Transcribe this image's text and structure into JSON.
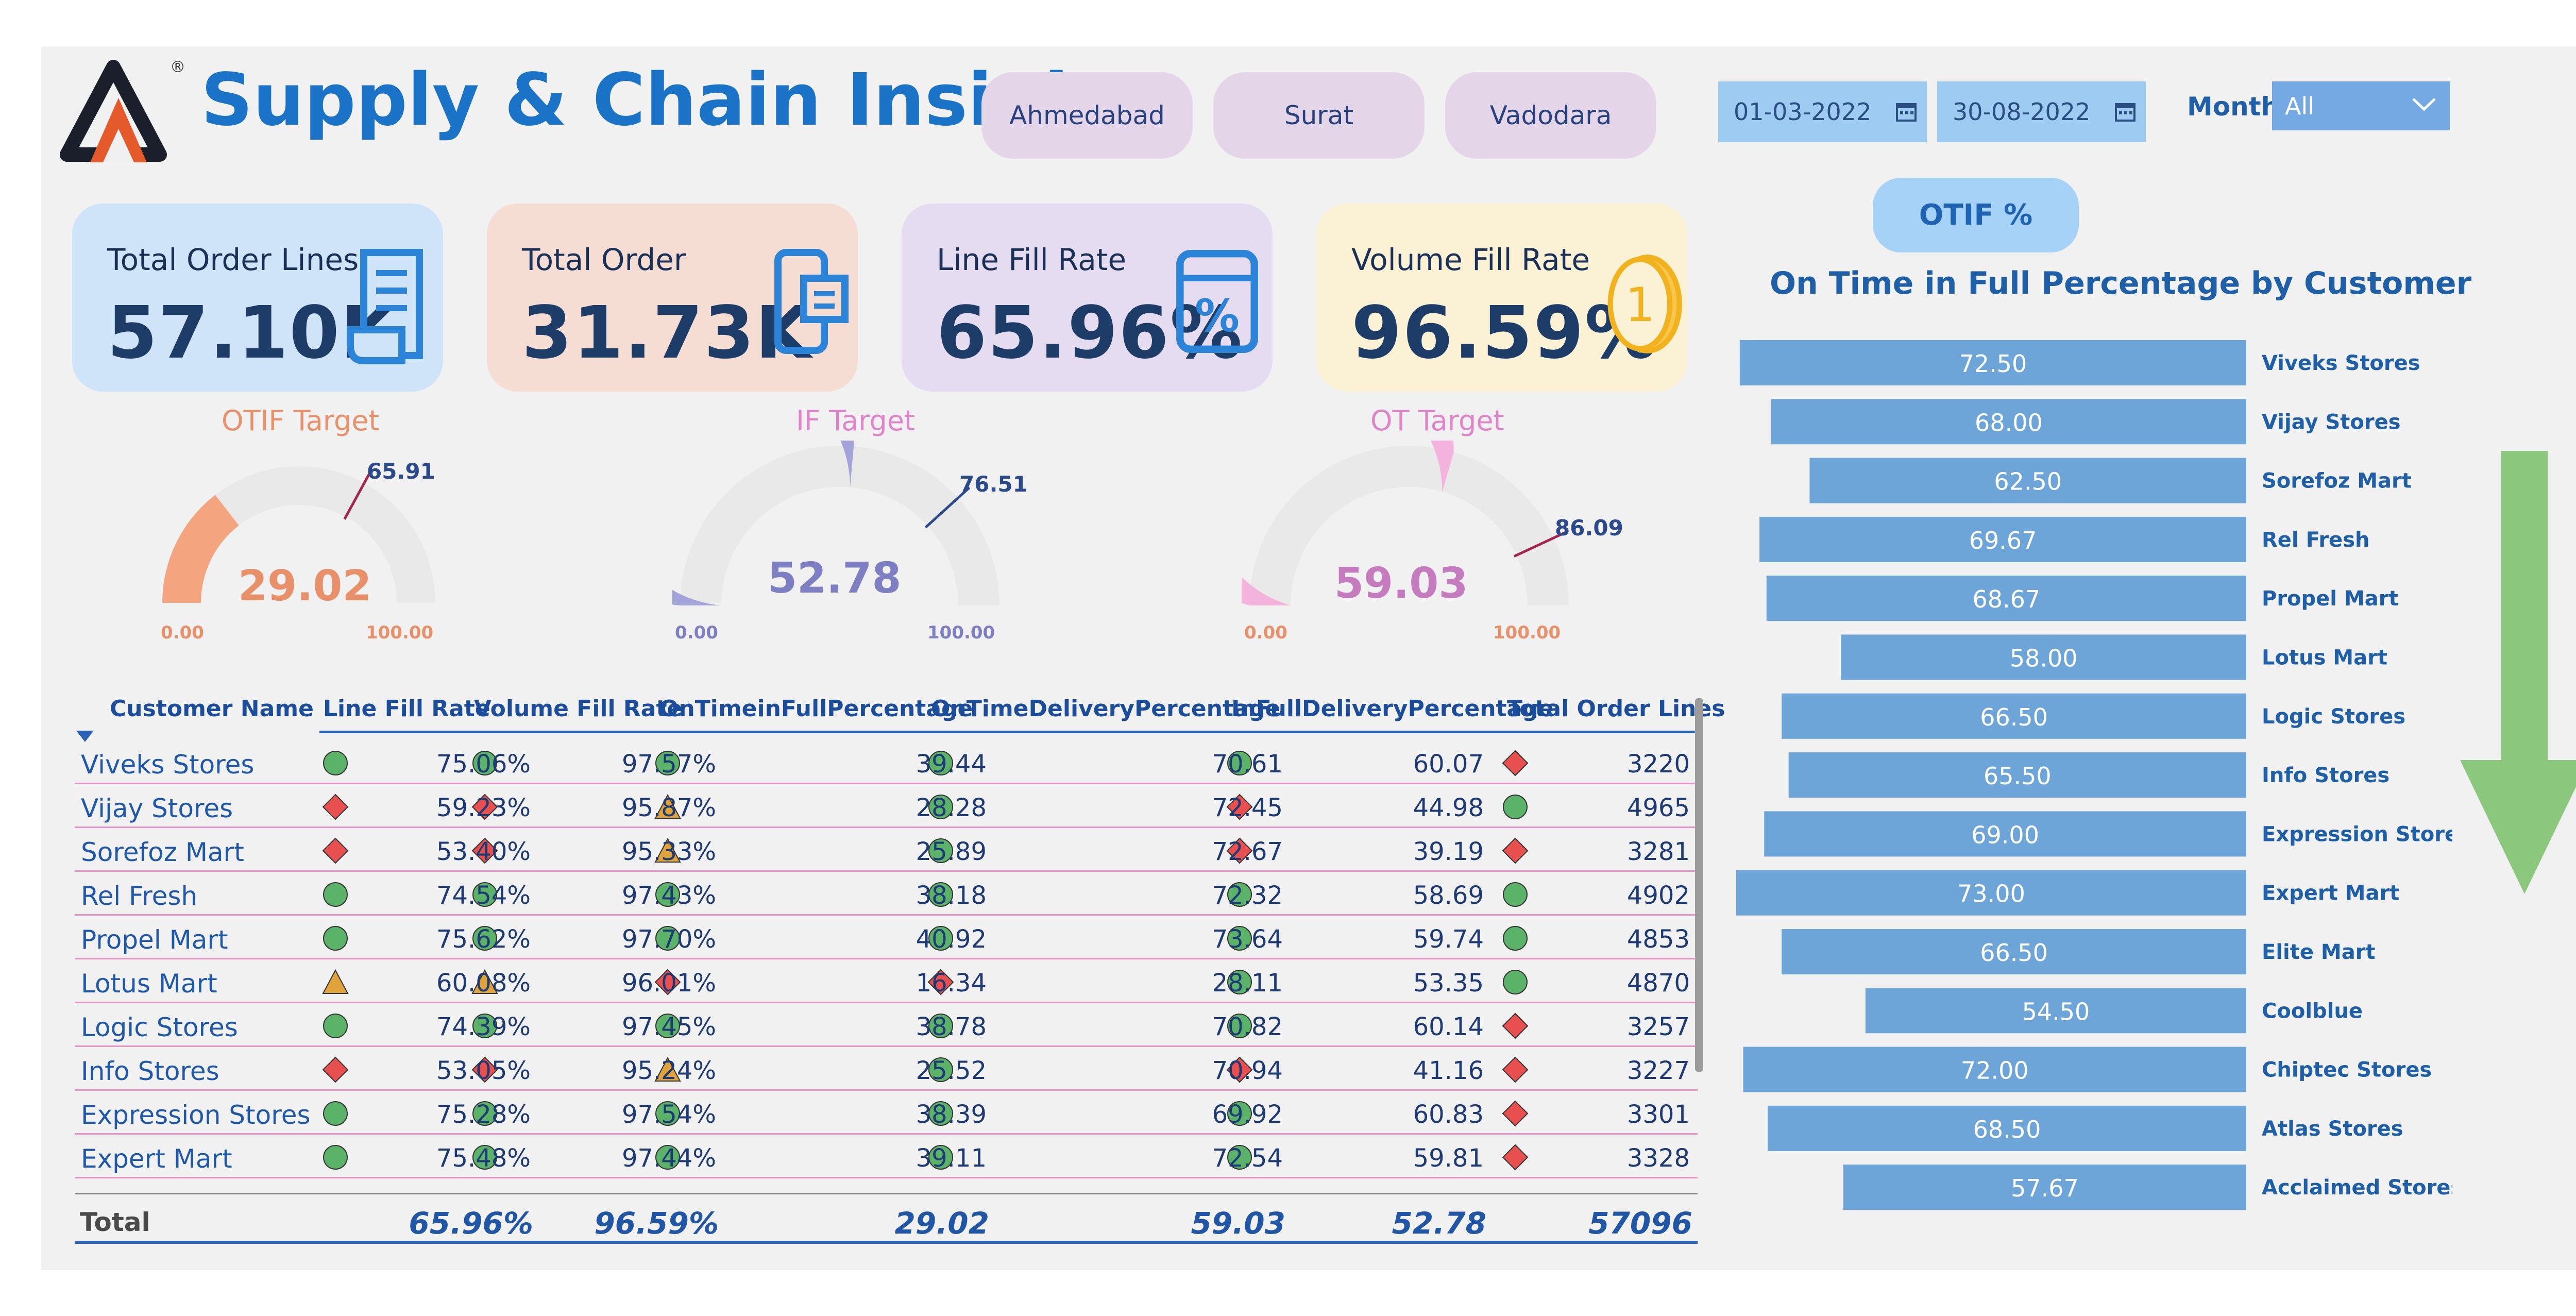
{
  "header": {
    "title": "Supply & Chain Insights",
    "cities": [
      "Ahmedabad",
      "Surat",
      "Vadodara"
    ],
    "start_date": "01-03-2022",
    "end_date": "30-08-2022",
    "month_label": "Month",
    "month_value": "All"
  },
  "kpis": [
    {
      "title": "Total Order Lines",
      "value": "57.10K",
      "icon": "document-icon",
      "bg": "#cfe4f8",
      "accent": "#2b84d8"
    },
    {
      "title": "Total Order",
      "value": "31.73K",
      "icon": "mobile-order-icon",
      "bg": "#f6ddd4",
      "accent": "#2b84d8"
    },
    {
      "title": "Line Fill Rate",
      "value": "65.96%",
      "icon": "percent-calculator-icon",
      "bg": "#e5dcf2",
      "accent": "#2b84d8"
    },
    {
      "title": "Volume Fill Rate",
      "value": "96.59%",
      "icon": "coin-icon",
      "bg": "#fbf2d6",
      "accent": "#f2b21e"
    }
  ],
  "gauges": [
    {
      "title": "OTIF Target",
      "value": "29.02",
      "target": "65.91",
      "min": "0.00",
      "max": "100.00",
      "fill_color": "#f4a47e",
      "text_color": "#e8906a",
      "value_num": 29.02,
      "target_num": 65.91
    },
    {
      "title": "IF Target",
      "value": "52.78",
      "target": "76.51",
      "min": "0.00",
      "max": "100.00",
      "fill_color": "#a3a3d9",
      "text_color": "#e084c9",
      "value_num": 52.78,
      "target_num": 76.51
    },
    {
      "title": "OT Target",
      "value": "59.03",
      "target": "86.09",
      "min": "0.00",
      "max": "100.00",
      "fill_color": "#f3b3dc",
      "text_color": "#e084c9",
      "value_num": 59.03,
      "target_num": 86.09
    }
  ],
  "table": {
    "columns": [
      "Customer Name",
      "Line Fill Rate",
      "Volume Fill Rate",
      "OnTimeinFullPercentage",
      "OnTimeDeliveryPercentage",
      "InFullDeliveryPercentage",
      "Total Order Lines"
    ],
    "rows": [
      {
        "name": "Viveks Stores",
        "lfr": "75.06%",
        "vfr": "97.57%",
        "otif": "39.44",
        "otd": "70.61",
        "ifd": "60.07",
        "tol": "3220",
        "i": [
          "circle",
          "circle",
          "circle",
          "circle",
          "circle",
          "diamond"
        ]
      },
      {
        "name": "Vijay Stores",
        "lfr": "59.23%",
        "vfr": "95.87%",
        "otif": "28.28",
        "otd": "72.45",
        "ifd": "44.98",
        "tol": "4965",
        "i": [
          "diamond",
          "diamond",
          "triangle",
          "circle",
          "diamond",
          "circle"
        ]
      },
      {
        "name": "Sorefoz Mart",
        "lfr": "53.40%",
        "vfr": "95.33%",
        "otif": "25.89",
        "otd": "72.67",
        "ifd": "39.19",
        "tol": "3281",
        "i": [
          "diamond",
          "diamond",
          "triangle",
          "circle",
          "diamond",
          "diamond"
        ]
      },
      {
        "name": "Rel Fresh",
        "lfr": "74.54%",
        "vfr": "97.43%",
        "otif": "38.18",
        "otd": "72.32",
        "ifd": "58.69",
        "tol": "4902",
        "i": [
          "circle",
          "circle",
          "circle",
          "circle",
          "circle",
          "circle"
        ]
      },
      {
        "name": "Propel Mart",
        "lfr": "75.62%",
        "vfr": "97.70%",
        "otif": "40.92",
        "otd": "73.64",
        "ifd": "59.74",
        "tol": "4853",
        "i": [
          "circle",
          "circle",
          "circle",
          "circle",
          "circle",
          "circle"
        ]
      },
      {
        "name": "Lotus Mart",
        "lfr": "60.08%",
        "vfr": "96.01%",
        "otif": "16.34",
        "otd": "28.11",
        "ifd": "53.35",
        "tol": "4870",
        "i": [
          "triangle",
          "triangle",
          "diamond",
          "diamond",
          "circle",
          "circle"
        ]
      },
      {
        "name": "Logic Stores",
        "lfr": "74.39%",
        "vfr": "97.45%",
        "otif": "38.78",
        "otd": "70.82",
        "ifd": "60.14",
        "tol": "3257",
        "i": [
          "circle",
          "circle",
          "circle",
          "circle",
          "circle",
          "diamond"
        ]
      },
      {
        "name": "Info Stores",
        "lfr": "53.05%",
        "vfr": "95.24%",
        "otif": "25.52",
        "otd": "70.94",
        "ifd": "41.16",
        "tol": "3227",
        "i": [
          "diamond",
          "diamond",
          "triangle",
          "circle",
          "diamond",
          "diamond"
        ]
      },
      {
        "name": "Expression Stores",
        "lfr": "75.28%",
        "vfr": "97.54%",
        "otif": "38.39",
        "otd": "69.92",
        "ifd": "60.83",
        "tol": "3301",
        "i": [
          "circle",
          "circle",
          "circle",
          "circle",
          "circle",
          "diamond"
        ]
      },
      {
        "name": "Expert Mart",
        "lfr": "75.48%",
        "vfr": "97.44%",
        "otif": "39.11",
        "otd": "72.54",
        "ifd": "59.81",
        "tol": "3328",
        "i": [
          "circle",
          "circle",
          "circle",
          "circle",
          "circle",
          "diamond"
        ]
      }
    ],
    "total": {
      "label": "Total",
      "lfr": "65.96%",
      "vfr": "96.59%",
      "otif": "29.02",
      "otd": "59.03",
      "ifd": "52.78",
      "tol": "57096"
    }
  },
  "otif_button": "OTIF %",
  "chart_data": {
    "type": "bar",
    "title": "On Time in Full Percentage by Customer",
    "categories": [
      "Viveks Stores",
      "Vijay Stores",
      "Sorefoz Mart",
      "Rel Fresh",
      "Propel Mart",
      "Lotus Mart",
      "Logic Stores",
      "Info Stores",
      "Expression Stores",
      "Expert Mart",
      "Elite Mart",
      "Coolblue",
      "Chiptec Stores",
      "Atlas Stores",
      "Acclaimed Stores"
    ],
    "values": [
      72.5,
      68.0,
      62.5,
      69.67,
      68.67,
      58.0,
      66.5,
      65.5,
      69.0,
      73.0,
      66.5,
      54.5,
      72.0,
      68.5,
      57.67
    ],
    "labels": [
      "72.50",
      "68.00",
      "62.50",
      "69.67",
      "68.67",
      "58.00",
      "66.50",
      "65.50",
      "69.00",
      "73.00",
      "66.50",
      "54.50",
      "72.00",
      "68.50",
      "57.67"
    ],
    "bar_color": "#6ea5d9",
    "orientation": "horizontal-right-aligned"
  },
  "colors": {
    "circle": "#5bb36a",
    "diamond": "#e8504f",
    "triangle": "#e0a23a",
    "arrow": "#8cc77e"
  }
}
